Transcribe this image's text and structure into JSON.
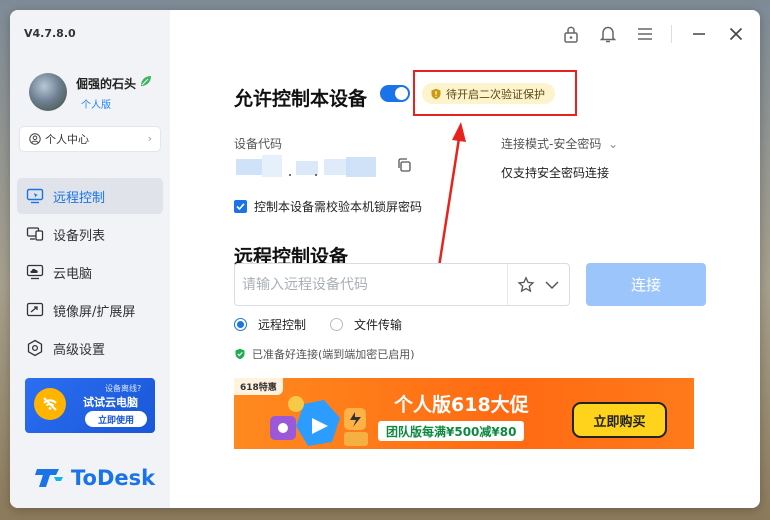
{
  "app": {
    "version": "V4.7.8.0",
    "logo_text": "ToDesk",
    "accent": "#1a73e8"
  },
  "user": {
    "name": "倔强的石头",
    "tier": "个人版"
  },
  "personal_center": {
    "label": "个人中心"
  },
  "nav": {
    "items": [
      {
        "label": "远程控制",
        "active": true
      },
      {
        "label": "设备列表"
      },
      {
        "label": "云电脑"
      },
      {
        "label": "镜像屏/扩展屏"
      },
      {
        "label": "高级设置"
      }
    ]
  },
  "cloud_promo": {
    "question": "设备离线?",
    "title": "试试云电脑",
    "button": "立即使用"
  },
  "allow": {
    "title": "允许控制本设备",
    "toggle_on": true,
    "warning": "待开启二次验证保护",
    "code_label": "设备代码",
    "mode_label": "连接模式-安全密码",
    "mode_desc": "仅支持安全密码连接",
    "lock_screen_label": "控制本设备需校验本机锁屏密码"
  },
  "remote": {
    "title": "远程控制设备",
    "placeholder": "请输入远程设备代码",
    "connect": "连接",
    "options": [
      "远程控制",
      "文件传输"
    ],
    "selected": "远程控制",
    "ready": "已准备好连接(端到端加密已启用)"
  },
  "banner": {
    "tag": "618特惠",
    "headline": "个人版618大促",
    "subline": "团队版每满¥500减¥80",
    "button": "立即购买"
  }
}
